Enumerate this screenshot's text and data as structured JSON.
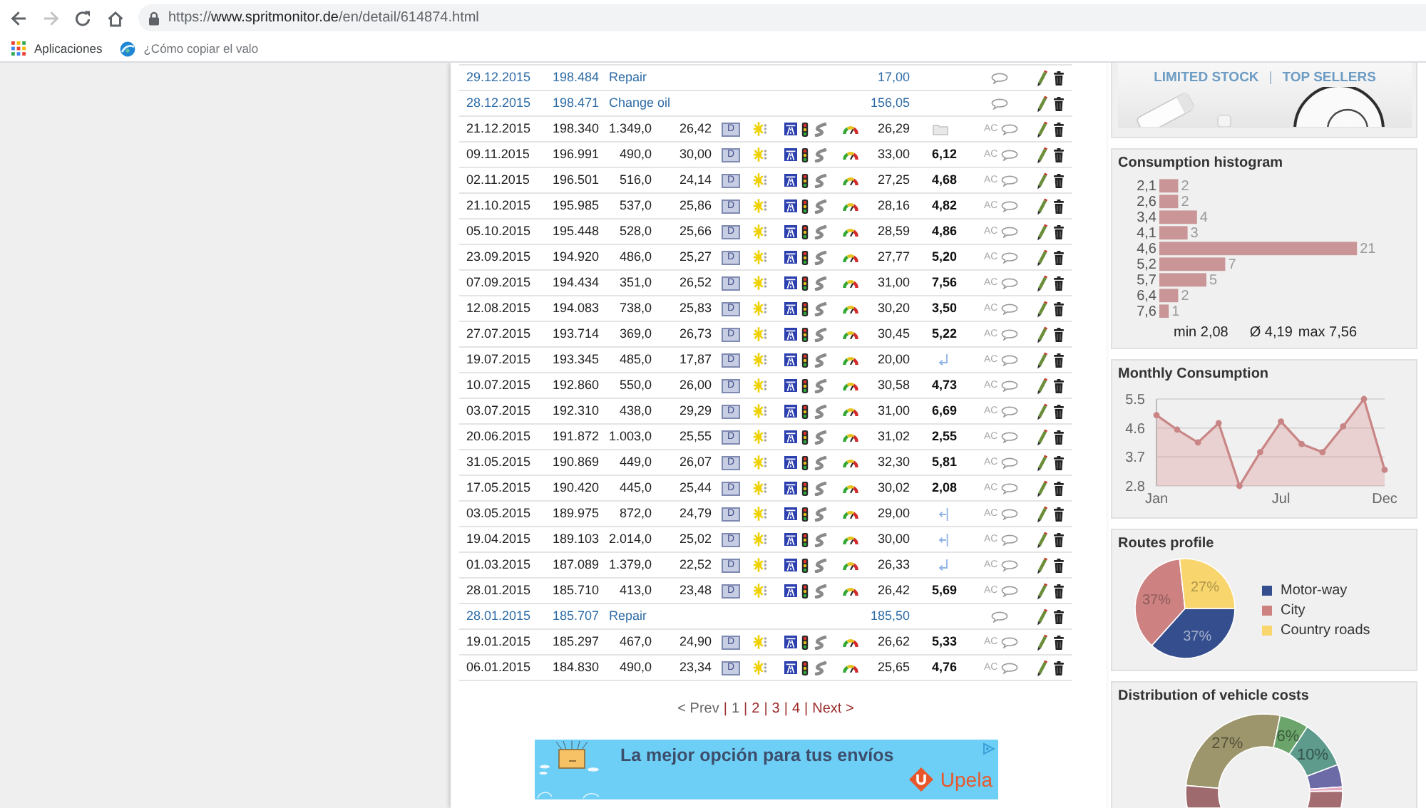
{
  "browser": {
    "back": {
      "disabled": false
    },
    "forward": {
      "disabled": true
    },
    "url": {
      "scheme": "https://",
      "host": "www.spritmonitor.de",
      "path": "/en/detail/614874.html"
    },
    "bookmarks": [
      {
        "kind": "apps",
        "label": "Aplicaciones",
        "faded": false
      },
      {
        "kind": "page",
        "label": "¿Cómo copiar el valo",
        "faded": true
      }
    ]
  },
  "fuel_log": {
    "rows": [
      {
        "kind": "cost",
        "date": "29.12.2015",
        "odometer": "198.484",
        "description": "Repair",
        "cost": "17,00"
      },
      {
        "kind": "cost",
        "date": "28.12.2015",
        "odometer": "198.471",
        "description": "Change oil",
        "cost": "156,05"
      },
      {
        "kind": "fuel",
        "date": "21.12.2015",
        "odometer": "198.340",
        "distance": "1.349,0",
        "quantity": "26,42",
        "fuel_type": "D",
        "cost": "26,29",
        "marker": {
          "kind": "folder"
        },
        "ac": "AC"
      },
      {
        "kind": "fuel",
        "date": "09.11.2015",
        "odometer": "196.991",
        "distance": "490,0",
        "quantity": "30,00",
        "fuel_type": "D",
        "cost": "33,00",
        "consumption": "6,12",
        "ac": "AC"
      },
      {
        "kind": "fuel",
        "date": "02.11.2015",
        "odometer": "196.501",
        "distance": "516,0",
        "quantity": "24,14",
        "fuel_type": "D",
        "cost": "27,25",
        "consumption": "4,68",
        "ac": "AC"
      },
      {
        "kind": "fuel",
        "date": "21.10.2015",
        "odometer": "195.985",
        "distance": "537,0",
        "quantity": "25,86",
        "fuel_type": "D",
        "cost": "28,16",
        "consumption": "4,82",
        "ac": "AC"
      },
      {
        "kind": "fuel",
        "date": "05.10.2015",
        "odometer": "195.448",
        "distance": "528,0",
        "quantity": "25,66",
        "fuel_type": "D",
        "cost": "28,59",
        "consumption": "4,86",
        "ac": "AC"
      },
      {
        "kind": "fuel",
        "date": "23.09.2015",
        "odometer": "194.920",
        "distance": "486,0",
        "quantity": "25,27",
        "fuel_type": "D",
        "cost": "27,77",
        "consumption": "5,20",
        "ac": "AC"
      },
      {
        "kind": "fuel",
        "date": "07.09.2015",
        "odometer": "194.434",
        "distance": "351,0",
        "quantity": "26,52",
        "fuel_type": "D",
        "cost": "31,00",
        "consumption": "7,56",
        "ac": "AC"
      },
      {
        "kind": "fuel",
        "date": "12.08.2015",
        "odometer": "194.083",
        "distance": "738,0",
        "quantity": "25,83",
        "fuel_type": "D",
        "cost": "30,20",
        "consumption": "3,50",
        "ac": "AC"
      },
      {
        "kind": "fuel",
        "date": "27.07.2015",
        "odometer": "193.714",
        "distance": "369,0",
        "quantity": "26,73",
        "fuel_type": "D",
        "cost": "30,45",
        "consumption": "5,22",
        "ac": "AC"
      },
      {
        "kind": "fuel",
        "date": "19.07.2015",
        "odometer": "193.345",
        "distance": "485,0",
        "quantity": "17,87",
        "fuel_type": "D",
        "cost": "20,00",
        "marker": {
          "kind": "return"
        },
        "ac": "AC"
      },
      {
        "kind": "fuel",
        "date": "10.07.2015",
        "odometer": "192.860",
        "distance": "550,0",
        "quantity": "26,00",
        "fuel_type": "D",
        "cost": "30,58",
        "consumption": "4,73",
        "ac": "AC"
      },
      {
        "kind": "fuel",
        "date": "03.07.2015",
        "odometer": "192.310",
        "distance": "438,0",
        "quantity": "29,29",
        "fuel_type": "D",
        "cost": "31,00",
        "consumption": "6,69",
        "ac": "AC"
      },
      {
        "kind": "fuel",
        "date": "20.06.2015",
        "odometer": "191.872",
        "distance": "1.003,0",
        "quantity": "25,55",
        "fuel_type": "D",
        "cost": "31,02",
        "consumption": "2,55",
        "ac": "AC"
      },
      {
        "kind": "fuel",
        "date": "31.05.2015",
        "odometer": "190.869",
        "distance": "449,0",
        "quantity": "26,07",
        "fuel_type": "D",
        "cost": "32,30",
        "consumption": "5,81",
        "ac": "AC"
      },
      {
        "kind": "fuel",
        "date": "17.05.2015",
        "odometer": "190.420",
        "distance": "445,0",
        "quantity": "25,44",
        "fuel_type": "D",
        "cost": "30,02",
        "consumption": "2,08",
        "ac": "AC"
      },
      {
        "kind": "fuel",
        "date": "03.05.2015",
        "odometer": "189.975",
        "distance": "872,0",
        "quantity": "24,79",
        "fuel_type": "D",
        "cost": "29,00",
        "marker": {
          "kind": "partial"
        },
        "ac": "AC"
      },
      {
        "kind": "fuel",
        "date": "19.04.2015",
        "odometer": "189.103",
        "distance": "2.014,0",
        "quantity": "25,02",
        "fuel_type": "D",
        "cost": "30,00",
        "marker": {
          "kind": "partial"
        },
        "ac": "AC"
      },
      {
        "kind": "fuel",
        "date": "01.03.2015",
        "odometer": "187.089",
        "distance": "1.379,0",
        "quantity": "22,52",
        "fuel_type": "D",
        "cost": "26,33",
        "marker": {
          "kind": "return"
        },
        "ac": "AC"
      },
      {
        "kind": "fuel",
        "date": "28.01.2015",
        "odometer": "185.710",
        "distance": "413,0",
        "quantity": "23,48",
        "fuel_type": "D",
        "cost": "26,42",
        "consumption": "5,69",
        "ac": "AC"
      },
      {
        "kind": "cost",
        "date": "28.01.2015",
        "odometer": "185.707",
        "description": "Repair",
        "cost": "185,50"
      },
      {
        "kind": "fuel",
        "date": "19.01.2015",
        "odometer": "185.297",
        "distance": "467,0",
        "quantity": "24,90",
        "fuel_type": "D",
        "cost": "26,62",
        "consumption": "5,33",
        "ac": "AC"
      },
      {
        "kind": "fuel",
        "date": "06.01.2015",
        "odometer": "184.830",
        "distance": "490,0",
        "quantity": "23,34",
        "fuel_type": "D",
        "cost": "25,65",
        "consumption": "4,76",
        "ac": "AC"
      }
    ]
  },
  "pagination": {
    "items": [
      {
        "kind": "link",
        "label": "< Prev",
        "disabled": true
      },
      {
        "kind": "separator",
        "label": "|"
      },
      {
        "kind": "page",
        "label": "1",
        "selected": true
      },
      {
        "kind": "separator",
        "label": "|"
      },
      {
        "kind": "page",
        "label": "2",
        "selected": false
      },
      {
        "kind": "separator",
        "label": "|"
      },
      {
        "kind": "page",
        "label": "3",
        "selected": false
      },
      {
        "kind": "separator",
        "label": "|"
      },
      {
        "kind": "page",
        "label": "4",
        "selected": false
      },
      {
        "kind": "separator",
        "label": "|"
      },
      {
        "kind": "link",
        "label": "Next >",
        "disabled": false
      }
    ]
  },
  "ad_banner": {
    "headline": "La mejor opción para tus envíos",
    "brand": "Upela"
  },
  "sidebar": {
    "promo": {
      "items": [
        {
          "kind": "link",
          "label": "LIMITED STOCK"
        },
        {
          "kind": "separator",
          "label": "|"
        },
        {
          "kind": "link",
          "label": "TOP SELLERS"
        }
      ]
    },
    "histogram": {
      "title": "Consumption histogram",
      "chart_data": {
        "type": "bar",
        "orientation": "horizontal",
        "categories": [
          "2,1",
          "2,6",
          "3,4",
          "4,1",
          "4,6",
          "5,2",
          "5,7",
          "6,4",
          "7,6"
        ],
        "values": [
          2,
          2,
          4,
          3,
          21,
          7,
          5,
          2,
          1
        ],
        "data_labels": true
      },
      "stats": [
        "min 2,08",
        "Ø 4,19",
        "max 7,56"
      ]
    },
    "monthly": {
      "title": "Monthly Consumption",
      "chart_data": {
        "type": "area",
        "categories": [
          "Jan",
          null,
          null,
          null,
          null,
          null,
          "Jul",
          null,
          null,
          null,
          null,
          "Dec"
        ],
        "values": [
          5.0,
          4.55,
          4.15,
          4.75,
          2.8,
          3.85,
          4.8,
          4.1,
          3.85,
          4.65,
          5.5,
          3.3
        ],
        "ylim": [
          2.8,
          5.5
        ],
        "yticks": [
          2.8,
          3.7,
          4.6,
          5.5
        ]
      }
    },
    "routes": {
      "title": "Routes profile",
      "chart_data": {
        "type": "pie",
        "values": [
          37,
          37,
          27
        ],
        "value_labels": [
          "37%",
          "37%",
          "27%"
        ]
      },
      "legend": [
        {
          "label": "Motor-way",
          "color": "#354e8d"
        },
        {
          "label": "City",
          "color": "#cd8181"
        },
        {
          "label": "Country roads",
          "color": "#f8d66d"
        }
      ]
    },
    "costs": {
      "title": "Distribution of vehicle costs",
      "slice_labels": [
        "27%",
        "6%",
        "10%"
      ]
    }
  }
}
